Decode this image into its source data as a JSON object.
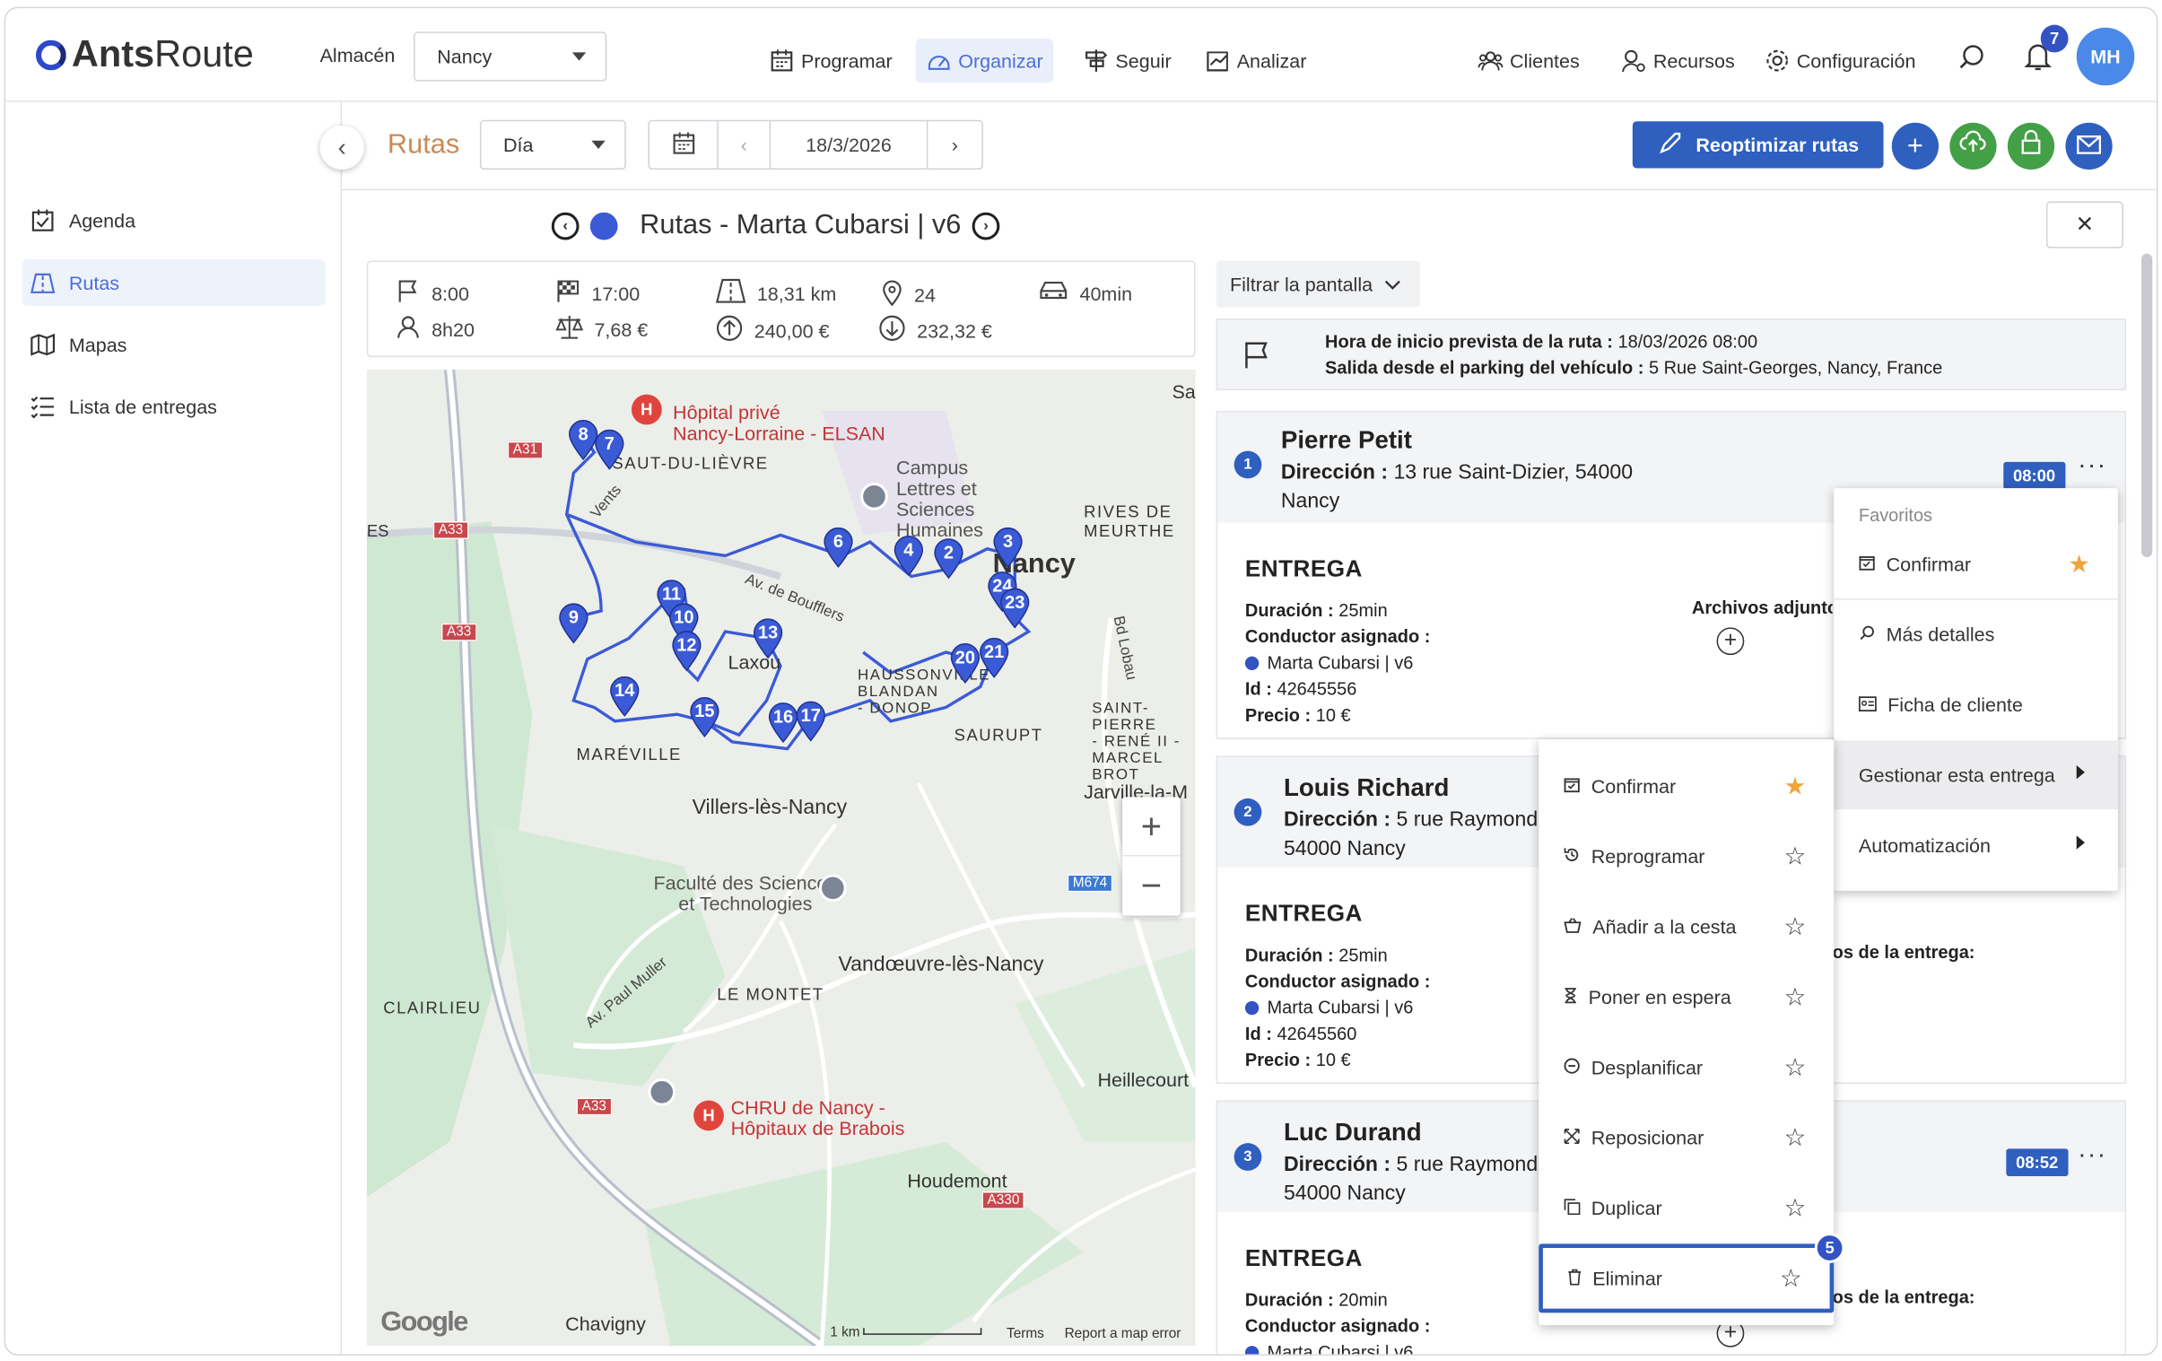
{
  "header": {
    "brand_a": "Ants",
    "brand_b": "Route",
    "warehouse_label": "Almacén",
    "warehouse_value": "Nancy",
    "nav": [
      {
        "label": "Programar",
        "icon": "calendar-grid-icon"
      },
      {
        "label": "Organizar",
        "icon": "dashboard-gauge-icon",
        "active": true
      },
      {
        "label": "Seguir",
        "icon": "signpost-icon"
      },
      {
        "label": "Analizar",
        "icon": "chart-icon"
      }
    ],
    "right_nav": [
      {
        "label": "Clientes",
        "icon": "clients-icon"
      },
      {
        "label": "Recursos",
        "icon": "resources-icon"
      },
      {
        "label": "Configuración",
        "icon": "gear-icon"
      }
    ],
    "notifications_count": "7",
    "avatar_initials": "MH"
  },
  "sidebar": {
    "items": [
      {
        "label": "Agenda",
        "icon": "agenda-icon"
      },
      {
        "label": "Rutas",
        "icon": "routes-icon",
        "active": true
      },
      {
        "label": "Mapas",
        "icon": "map-icon"
      },
      {
        "label": "Lista de entregas",
        "icon": "list-icon"
      }
    ]
  },
  "toolbar": {
    "section_title": "Rutas",
    "view_value": "Día",
    "date_value": "18/3/2026",
    "reoptimize_label": "Reoptimizar rutas"
  },
  "route": {
    "title": "Rutas - Marta Cubarsi | v6",
    "stats": {
      "start": "8:00",
      "end": "17:00",
      "distance": "18,31 km",
      "stops": "24",
      "drive_time": "40min",
      "duration": "8h20",
      "cost": "7,68 €",
      "revenue": "240,00 €",
      "margin": "232,32 €"
    }
  },
  "map": {
    "labels": {
      "hospital_1": "Hôpital privé",
      "hospital_1b": "Nancy-Lorraine - ELSAN",
      "area_1": "SAUT-DU-LIÈVRE",
      "campus_1": "Campus",
      "campus_2": "Lettres et",
      "campus_3": "Sciences",
      "campus_4": "Humaines",
      "rives": "RIVES DE",
      "meurthe": "MEURTHE",
      "nancy": "Nancy",
      "laxou": "Laxou",
      "haussonville": "HAUSSONVILLE",
      "blandan": "BLANDAN",
      "donop": "- DONOP",
      "saurupt": "SAURUPT",
      "st_pierre_1": "SAINT-PIERRE",
      "st_pierre_2": "- RENÉ II -",
      "st_pierre_3": "MARCEL BROT",
      "mareville": "MARÉVILLE",
      "villers": "Villers-lès-Nancy",
      "jarville": "Jarville-la-M",
      "fac_1": "Faculté des Sciences",
      "fac_2": "et Technologies",
      "vandoeuvre": "Vandœuvre-lès-Nancy",
      "le_montet": "LE MONTET",
      "clairlieu": "CLAIRLIEU",
      "heillecourt": "Heillecourt",
      "chru_1": "CHRU de Nancy -",
      "chru_2": "Hôpitaux de Brabois",
      "houdemont": "Houdemont",
      "chavigny": "Chavigny",
      "sa": "Sa",
      "es": "ES",
      "av_boufflers": "Av. de Boufflers",
      "av_paul_muller": "Av. Paul Muller",
      "bd_lobau": "Bd Lobau",
      "vents": "Vents",
      "a31": "A31",
      "a33a": "A33",
      "a33b": "A33",
      "a33c": "A33",
      "m674": "M674",
      "a330": "A330",
      "scale": "1 km",
      "terms": "Terms",
      "report": "Report a map error",
      "google": "Google"
    },
    "markers": [
      "8",
      "7",
      "6",
      "4",
      "2",
      "24",
      "23",
      "11",
      "10",
      "9",
      "12",
      "13",
      "14",
      "15",
      "16",
      "17",
      "20",
      "21",
      "3"
    ]
  },
  "panel": {
    "filter_label": "Filtrar la pantalla",
    "start_time_label": "Hora de inicio prevista de la ruta :",
    "start_time_value": "18/03/2026 08:00",
    "departure_label": "Salida desde el parking del vehículo :",
    "departure_value": "5 Rue Saint-Georges, Nancy, France",
    "address_label": "Dirección :",
    "delivery_title": "ENTREGA",
    "duration_label": "Duración :",
    "driver_label": "Conductor asignado :",
    "id_label": "Id :",
    "price_label": "Precio :",
    "attachments_label": "Archivos adjunto",
    "delivery_attachments_label": "os de la entrega:",
    "stops": [
      {
        "num": "1",
        "name": "Pierre Petit",
        "address_l1": "13 rue Saint-Dizier, 54000",
        "address_l2": "Nancy",
        "time": "08:00",
        "duration": "25min",
        "driver": "Marta Cubarsi | v6",
        "id": "42645556",
        "price": "10 €"
      },
      {
        "num": "2",
        "name": "Louis Richard",
        "address_l1": "5 rue Raymond",
        "address_l2": "54000 Nancy",
        "time": "",
        "duration": "25min",
        "driver": "Marta Cubarsi | v6",
        "id": "42645560",
        "price": "10 €"
      },
      {
        "num": "3",
        "name": "Luc Durand",
        "address_l1": "5 rue Raymond",
        "address_l2": "54000 Nancy",
        "time": "08:52",
        "duration": "20min",
        "driver": "Marta Cubarsi | v6",
        "id": "",
        "price": ""
      }
    ]
  },
  "context_menu": {
    "favorites_header": "Favoritos",
    "favorite_confirm": "Confirmar",
    "more_details": "Más detalles",
    "client_sheet": "Ficha de cliente",
    "manage_delivery": "Gestionar esta entrega",
    "automation": "Automatización"
  },
  "submenu": {
    "items": [
      {
        "label": "Confirmar",
        "starred": true
      },
      {
        "label": "Reprogramar",
        "starred": false
      },
      {
        "label": "Añadir a la cesta",
        "starred": false
      },
      {
        "label": "Poner en espera",
        "starred": false
      },
      {
        "label": "Desplanificar",
        "starred": false
      },
      {
        "label": "Reposicionar",
        "starred": false
      },
      {
        "label": "Duplicar",
        "starred": false
      },
      {
        "label": "Eliminar",
        "starred": false
      }
    ],
    "step_badge": "5"
  },
  "colors": {
    "primary": "#2f5fbf",
    "accent_orange": "#c98a55",
    "green": "#43a047",
    "route_line": "#3b5bd6",
    "star": "#f0a43a"
  }
}
